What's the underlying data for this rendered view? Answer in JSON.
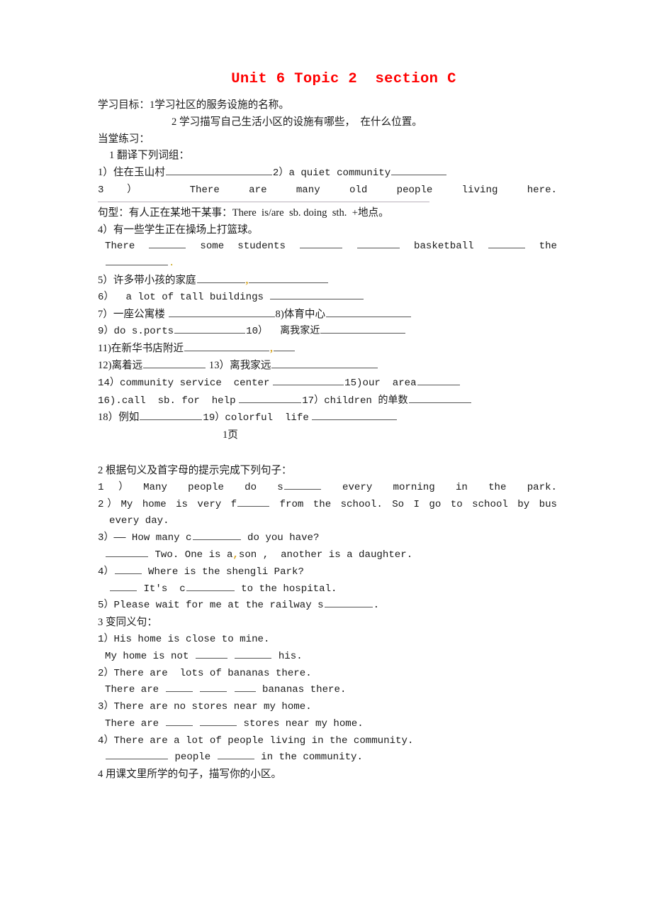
{
  "document": {
    "title": "Unit 6 Topic 2  section C",
    "title_color": "#ff0000",
    "page_marker": "1页",
    "objectives": {
      "label": "学习目标：1学习社区的服务设施的名称。",
      "line2": "2 学习描写自己生活小区的设施有哪些，  在什么位置。"
    },
    "practice_heading": "当堂练习：",
    "section1": {
      "heading": "1 翻译下列词组：",
      "item1_label": "1）住在玉山村",
      "item2_label": "2）",
      "item2_text": "a quiet community",
      "item3_label": "3）",
      "item3_text": "There are many old people living here.",
      "pattern_line": "句型：有人正在某地干某事：There  is/are  sb. doing  sth.  +地点。",
      "item4_label": "4）",
      "item4_text": "有一些学生正在操场上打篮球。",
      "item4_answer_a": "There",
      "item4_answer_b": "some",
      "item4_answer_c": "students",
      "item4_answer_d": "basketball",
      "item4_answer_e": "the",
      "item5": "5）许多带小孩的家庭",
      "item6": "6）  a lot of tall buildings",
      "item7": "7）一座公寓楼",
      "item8": "8)体育中心",
      "item9": "9）do s.ports",
      "item10": "10）  离我家近",
      "item11": "11)在新华书店附近",
      "item12": "12)离着远",
      "item13": "13）离我家远",
      "item14": "14）community service  center",
      "item15": "15)our  area",
      "item16": "16).call  sb. for  help",
      "item17": "17）children 的单数",
      "item18": "18）例如",
      "item19": "19）colorful  life"
    },
    "section2": {
      "heading": "2 根据句义及首字母的提示完成下列句子：",
      "q1": "1）Many people do s",
      "q1_tail": "every morning in the park.",
      "q2": "2）My home is very f",
      "q2_tail": "from the school. So I go to school by bus",
      "q2_cont": "every day.",
      "q3": "3）—— How many c",
      "q3_tail": "do you have?",
      "q3_ans_tail": "Two. One is a",
      "q3_ans_tail2": "son ,  another is a daughter.",
      "q4": "4）",
      "q4_tail": "Where is the shengli Park?",
      "q4_ans_a": "It's",
      "q4_ans_b": "c",
      "q4_ans_tail": "to the hospital.",
      "q5": "5）Please wait for me at the railway s",
      "q5_tail": "."
    },
    "section3": {
      "heading": "3 变同义句：",
      "s1_a": "1）His home is close to mine.",
      "s1_b_pre": "My home is not",
      "s1_b_post": "his.",
      "s2_a": "2）There are  lots of bananas there.",
      "s2_b_pre": "There are",
      "s2_b_post": "bananas there.",
      "s3_a": "3）There are no stores near my home.",
      "s3_b_pre": "There are",
      "s3_b_post": "stores near my home.",
      "s4_a": "4）There are a lot of people living in the community.",
      "s4_b_mid": "people",
      "s4_b_post": "in the community."
    },
    "section4": {
      "heading": "4 用课文里所学的句子，描写你的小区。"
    }
  }
}
